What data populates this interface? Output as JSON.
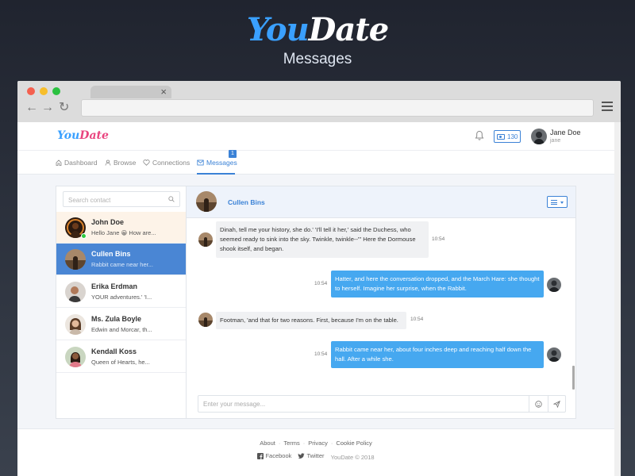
{
  "hero": {
    "logo_you": "You",
    "logo_date": "Date",
    "title": "Messages"
  },
  "browser": {
    "tab_close": "×",
    "back": "←",
    "forward": "→",
    "reload": "↻"
  },
  "app": {
    "logo_you": "You",
    "logo_date": "Date",
    "credits": "130",
    "user": {
      "name": "Jane Doe",
      "handle": "jane"
    }
  },
  "nav": {
    "dashboard": "Dashboard",
    "browse": "Browse",
    "connections": "Connections",
    "messages": "Messages",
    "messages_badge": "1"
  },
  "contacts": {
    "search_placeholder": "Search contact",
    "items": [
      {
        "name": "John Doe",
        "preview": "Hello Jane 😀 How are..."
      },
      {
        "name": "Cullen Bins",
        "preview": "Rabbit came near her..."
      },
      {
        "name": "Erika Erdman",
        "preview": "YOUR adventures.' 'I..."
      },
      {
        "name": "Ms. Zula Boyle",
        "preview": "Edwin and Morcar, th..."
      },
      {
        "name": "Kendall Koss",
        "preview": "Queen of Hearts, he..."
      }
    ]
  },
  "chat": {
    "contact_name": "Cullen Bins",
    "input_placeholder": "Enter your message...",
    "messages": [
      {
        "direction": "in",
        "text": "Dinah, tell me your history, she do.' 'I'll tell it her,' said the Duchess, who seemed ready to sink into the sky. Twinkle, twinkle--\"' Here the Dormouse shook itself, and began.",
        "time": "10:54"
      },
      {
        "direction": "out",
        "text": "Hatter, and here the conversation dropped, and the March Hare: she thought to herself. Imagine her surprise, when the Rabbit.",
        "time": "10:54"
      },
      {
        "direction": "in",
        "text": "Footman, 'and that for two reasons. First, because I'm on the table.",
        "time": "10:54"
      },
      {
        "direction": "out",
        "text": "Rabbit came near her, about four inches deep and reaching half down the hall. After a while she.",
        "time": "10:54"
      }
    ]
  },
  "footer": {
    "links": [
      "About",
      "Terms",
      "Privacy",
      "Cookie Policy"
    ],
    "separator": "·",
    "facebook": "Facebook",
    "twitter": "Twitter",
    "copyright": "YouDate © 2018"
  },
  "colors": {
    "accent": "#3b82d6",
    "brand_blue": "#3aa0ff",
    "brand_pink": "#e9457f",
    "outgoing_bubble": "#46a8f0",
    "selected_contact": "#4a86d4",
    "unread_contact": "#fdf3e8",
    "online": "#2ecc40"
  }
}
